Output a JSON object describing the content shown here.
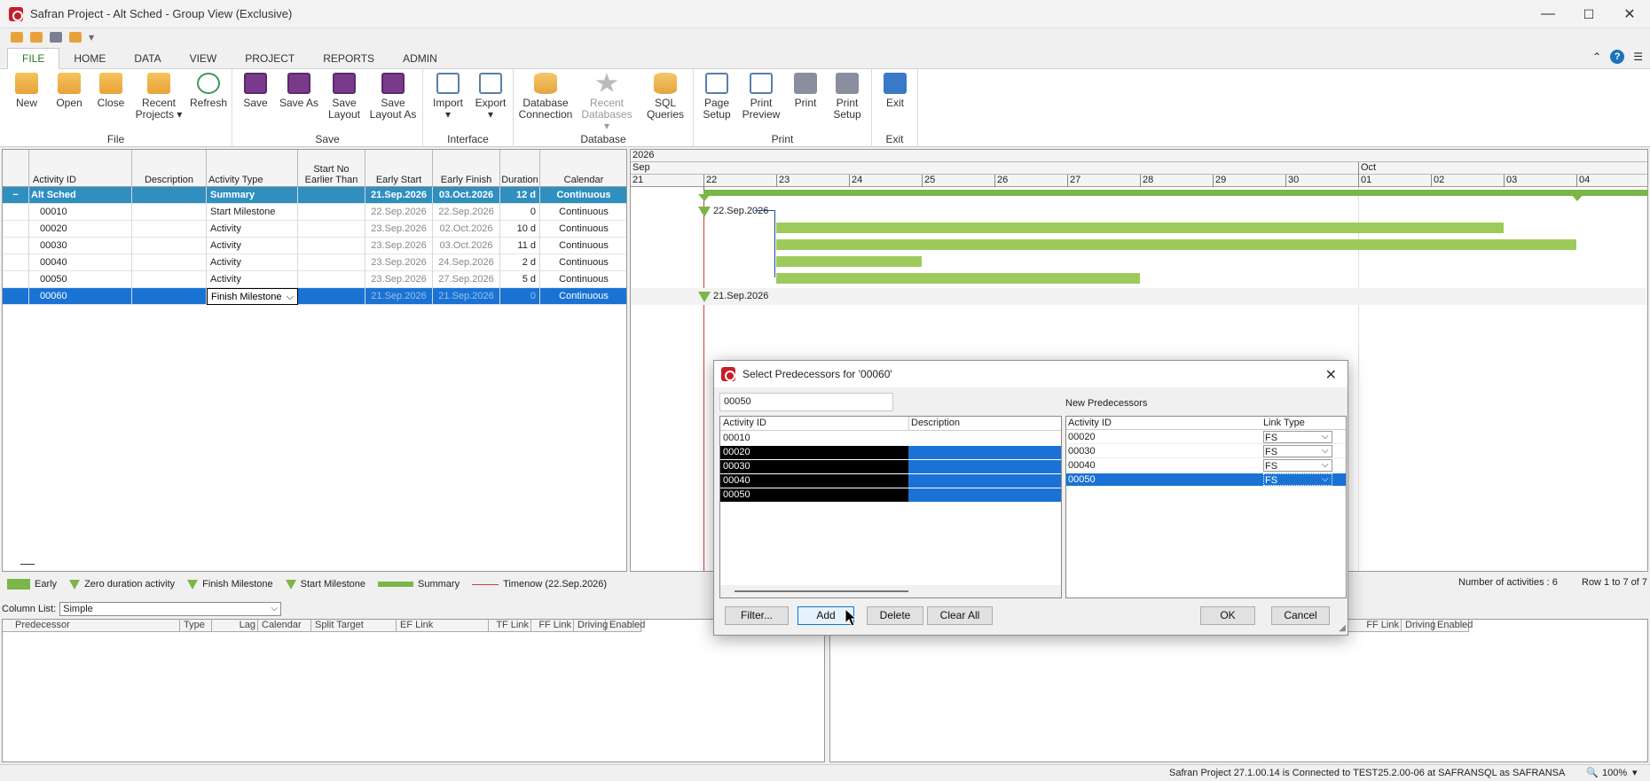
{
  "window": {
    "title": "Safran Project - Alt Sched - Group View (Exclusive)",
    "minimize": "—",
    "maximize": "☐",
    "close": "✕"
  },
  "ribbon": {
    "tabs": [
      "FILE",
      "HOME",
      "DATA",
      "VIEW",
      "PROJECT",
      "REPORTS",
      "ADMIN"
    ],
    "active_tab": "FILE",
    "groups": {
      "file": {
        "label": "File",
        "new": "New",
        "open": "Open",
        "close": "Close",
        "recent_projects": "Recent Projects ▾",
        "refresh": "Refresh"
      },
      "save": {
        "label": "Save",
        "save": "Save",
        "save_as": "Save As",
        "save_layout": "Save Layout",
        "save_layout_as": "Save Layout As"
      },
      "interface": {
        "label": "Interface",
        "import": "Import",
        "export": "Export"
      },
      "database": {
        "label": "Database",
        "db_connection": "Database Connection",
        "recent_databases": "Recent Databases ▾",
        "sql_queries": "SQL Queries"
      },
      "print": {
        "label": "Print",
        "page_setup": "Page Setup",
        "print_preview": "Print Preview",
        "print": "Print",
        "print_setup": "Print Setup"
      },
      "exit": {
        "label": "Exit",
        "exit": "Exit"
      }
    }
  },
  "grid": {
    "headers": [
      "Activity ID",
      "Description",
      "Activity Type",
      "Start No Earlier Than",
      "Early Start",
      "Early Finish",
      "Duration",
      "Calendar"
    ],
    "rows": [
      {
        "id": "Alt Sched",
        "desc": "",
        "type": "Summary",
        "snet": "",
        "es": "21.Sep.2026",
        "ef": "03.Oct.2026",
        "dur": "12 d",
        "cal": "Continuous"
      },
      {
        "id": "00010",
        "desc": "",
        "type": "Start Milestone",
        "snet": "",
        "es": "22.Sep.2026",
        "ef": "22.Sep.2026",
        "dur": "0",
        "cal": "Continuous"
      },
      {
        "id": "00020",
        "desc": "",
        "type": "Activity",
        "snet": "",
        "es": "23.Sep.2026",
        "ef": "02.Oct.2026",
        "dur": "10 d",
        "cal": "Continuous"
      },
      {
        "id": "00030",
        "desc": "",
        "type": "Activity",
        "snet": "",
        "es": "23.Sep.2026",
        "ef": "03.Oct.2026",
        "dur": "11 d",
        "cal": "Continuous"
      },
      {
        "id": "00040",
        "desc": "",
        "type": "Activity",
        "snet": "",
        "es": "23.Sep.2026",
        "ef": "24.Sep.2026",
        "dur": "2 d",
        "cal": "Continuous"
      },
      {
        "id": "00050",
        "desc": "",
        "type": "Activity",
        "snet": "",
        "es": "23.Sep.2026",
        "ef": "27.Sep.2026",
        "dur": "5 d",
        "cal": "Continuous"
      },
      {
        "id": "00060",
        "desc": "",
        "type": "Finish Milestone",
        "snet": "",
        "es": "21.Sep.2026",
        "ef": "21.Sep.2026",
        "dur": "0",
        "cal": "Continuous"
      }
    ],
    "collapse_glyph": "−"
  },
  "gantt": {
    "year": "2026",
    "months": [
      "Sep",
      "Oct"
    ],
    "days": [
      "21",
      "22",
      "23",
      "24",
      "25",
      "26",
      "27",
      "28",
      "29",
      "30",
      "01",
      "02",
      "03",
      "04"
    ],
    "labels": {
      "m00010": "22.Sep.2026",
      "m00060": "21.Sep.2026"
    },
    "bar_color": "#9dcb5b",
    "timenow_color": "#d63a3a"
  },
  "legend": {
    "early": "Early",
    "zero_duration": "Zero duration activity",
    "finish_milestone": "Finish Milestone",
    "start_milestone": "Start Milestone",
    "summary": "Summary",
    "timenow": "Timenow (22.Sep.2026)",
    "activity_count": "Number of activities : 6",
    "row_info": "Row 1 to 7 of 7"
  },
  "bottom": {
    "column_list_label": "Column List:",
    "column_list_value": "Simple",
    "pred_headers": [
      "Predecessor",
      "Type",
      "Lag",
      "Calendar",
      "Split Target",
      "EF Link",
      "TF Link",
      "FF Link",
      "Driving",
      "Enabled"
    ],
    "succ_headers": [
      "FF Link",
      "Driving",
      "Enabled"
    ]
  },
  "statusbar": {
    "connection": "Safran Project 27.1.00.14 is Connected to TEST25.2.00-06 at SAFRANSQL as SAFRANSA",
    "zoom": "100%"
  },
  "dialog": {
    "title": "Select Predecessors for '00060'",
    "search_value": "00050",
    "list_headers": [
      "Activity ID",
      "Description"
    ],
    "list_rows": [
      {
        "id": "00010",
        "selected": false
      },
      {
        "id": "00020",
        "selected": true
      },
      {
        "id": "00030",
        "selected": true
      },
      {
        "id": "00040",
        "selected": true
      },
      {
        "id": "00050",
        "selected": true
      }
    ],
    "new_pred_label": "New Predecessors",
    "new_pred_headers": [
      "Activity ID",
      "Link Type"
    ],
    "new_preds": [
      {
        "id": "00020",
        "link": "FS",
        "selected": false
      },
      {
        "id": "00030",
        "link": "FS",
        "selected": false
      },
      {
        "id": "00040",
        "link": "FS",
        "selected": false
      },
      {
        "id": "00050",
        "link": "FS",
        "selected": true
      }
    ],
    "buttons": {
      "filter": "Filter...",
      "add": "Add",
      "delete": "Delete",
      "clear_all": "Clear All",
      "ok": "OK",
      "cancel": "Cancel"
    }
  }
}
